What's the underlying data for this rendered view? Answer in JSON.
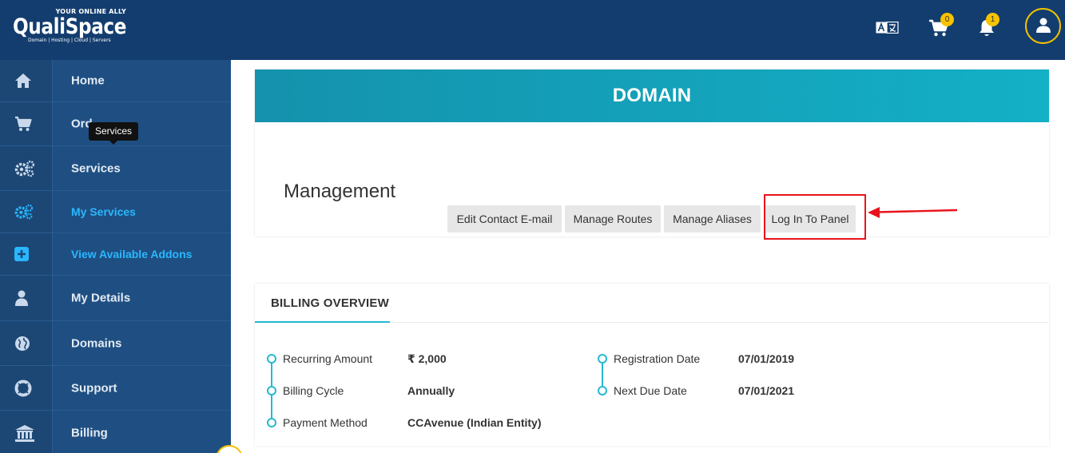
{
  "header": {
    "logo": {
      "tagline": "YOUR ONLINE ALLY",
      "name": "QualiSpace",
      "subline": "Domain | Hosting | Cloud | Servers"
    },
    "icons": [
      "translate-icon",
      "cart-icon",
      "bell-icon",
      "user-icon"
    ],
    "cart_count": "0",
    "notification_count": "1"
  },
  "sidebar": {
    "items": [
      {
        "label": "Home",
        "icon": "home-icon"
      },
      {
        "label": "Ord",
        "icon": "cart-icon"
      },
      {
        "label": "Services",
        "icon": "gears-icon"
      },
      {
        "label": "My Services",
        "icon": "gears-icon",
        "active": true
      },
      {
        "label": "View Available Addons",
        "icon": "plus-square-icon",
        "active": true
      },
      {
        "label": "My Details",
        "icon": "user-icon"
      },
      {
        "label": "Domains",
        "icon": "globe-icon"
      },
      {
        "label": "Support",
        "icon": "life-ring-icon"
      },
      {
        "label": "Billing",
        "icon": "bank-icon"
      }
    ],
    "tooltip": "Services"
  },
  "domain": {
    "title": "DOMAIN",
    "management_title": "Management",
    "buttons": [
      "Edit Contact E-mail",
      "Manage Routes",
      "Manage Aliases",
      "Log In To Panel"
    ]
  },
  "billing": {
    "title": "BILLING OVERVIEW",
    "left": [
      {
        "label": "Recurring Amount",
        "value": "₹ 2,000"
      },
      {
        "label": "Billing Cycle",
        "value": "Annually"
      },
      {
        "label": "Payment Method",
        "value": "CCAvenue (Indian Entity)"
      }
    ],
    "right": [
      {
        "label": "Registration Date",
        "value": "07/01/2019"
      },
      {
        "label": "Next Due Date",
        "value": "07/01/2021"
      }
    ]
  },
  "colors": {
    "header": "#133d6e",
    "sidebar": "#1f4f82",
    "accent": "#25b9d2",
    "highlight": "#e8141b",
    "badge": "#f7c200"
  }
}
